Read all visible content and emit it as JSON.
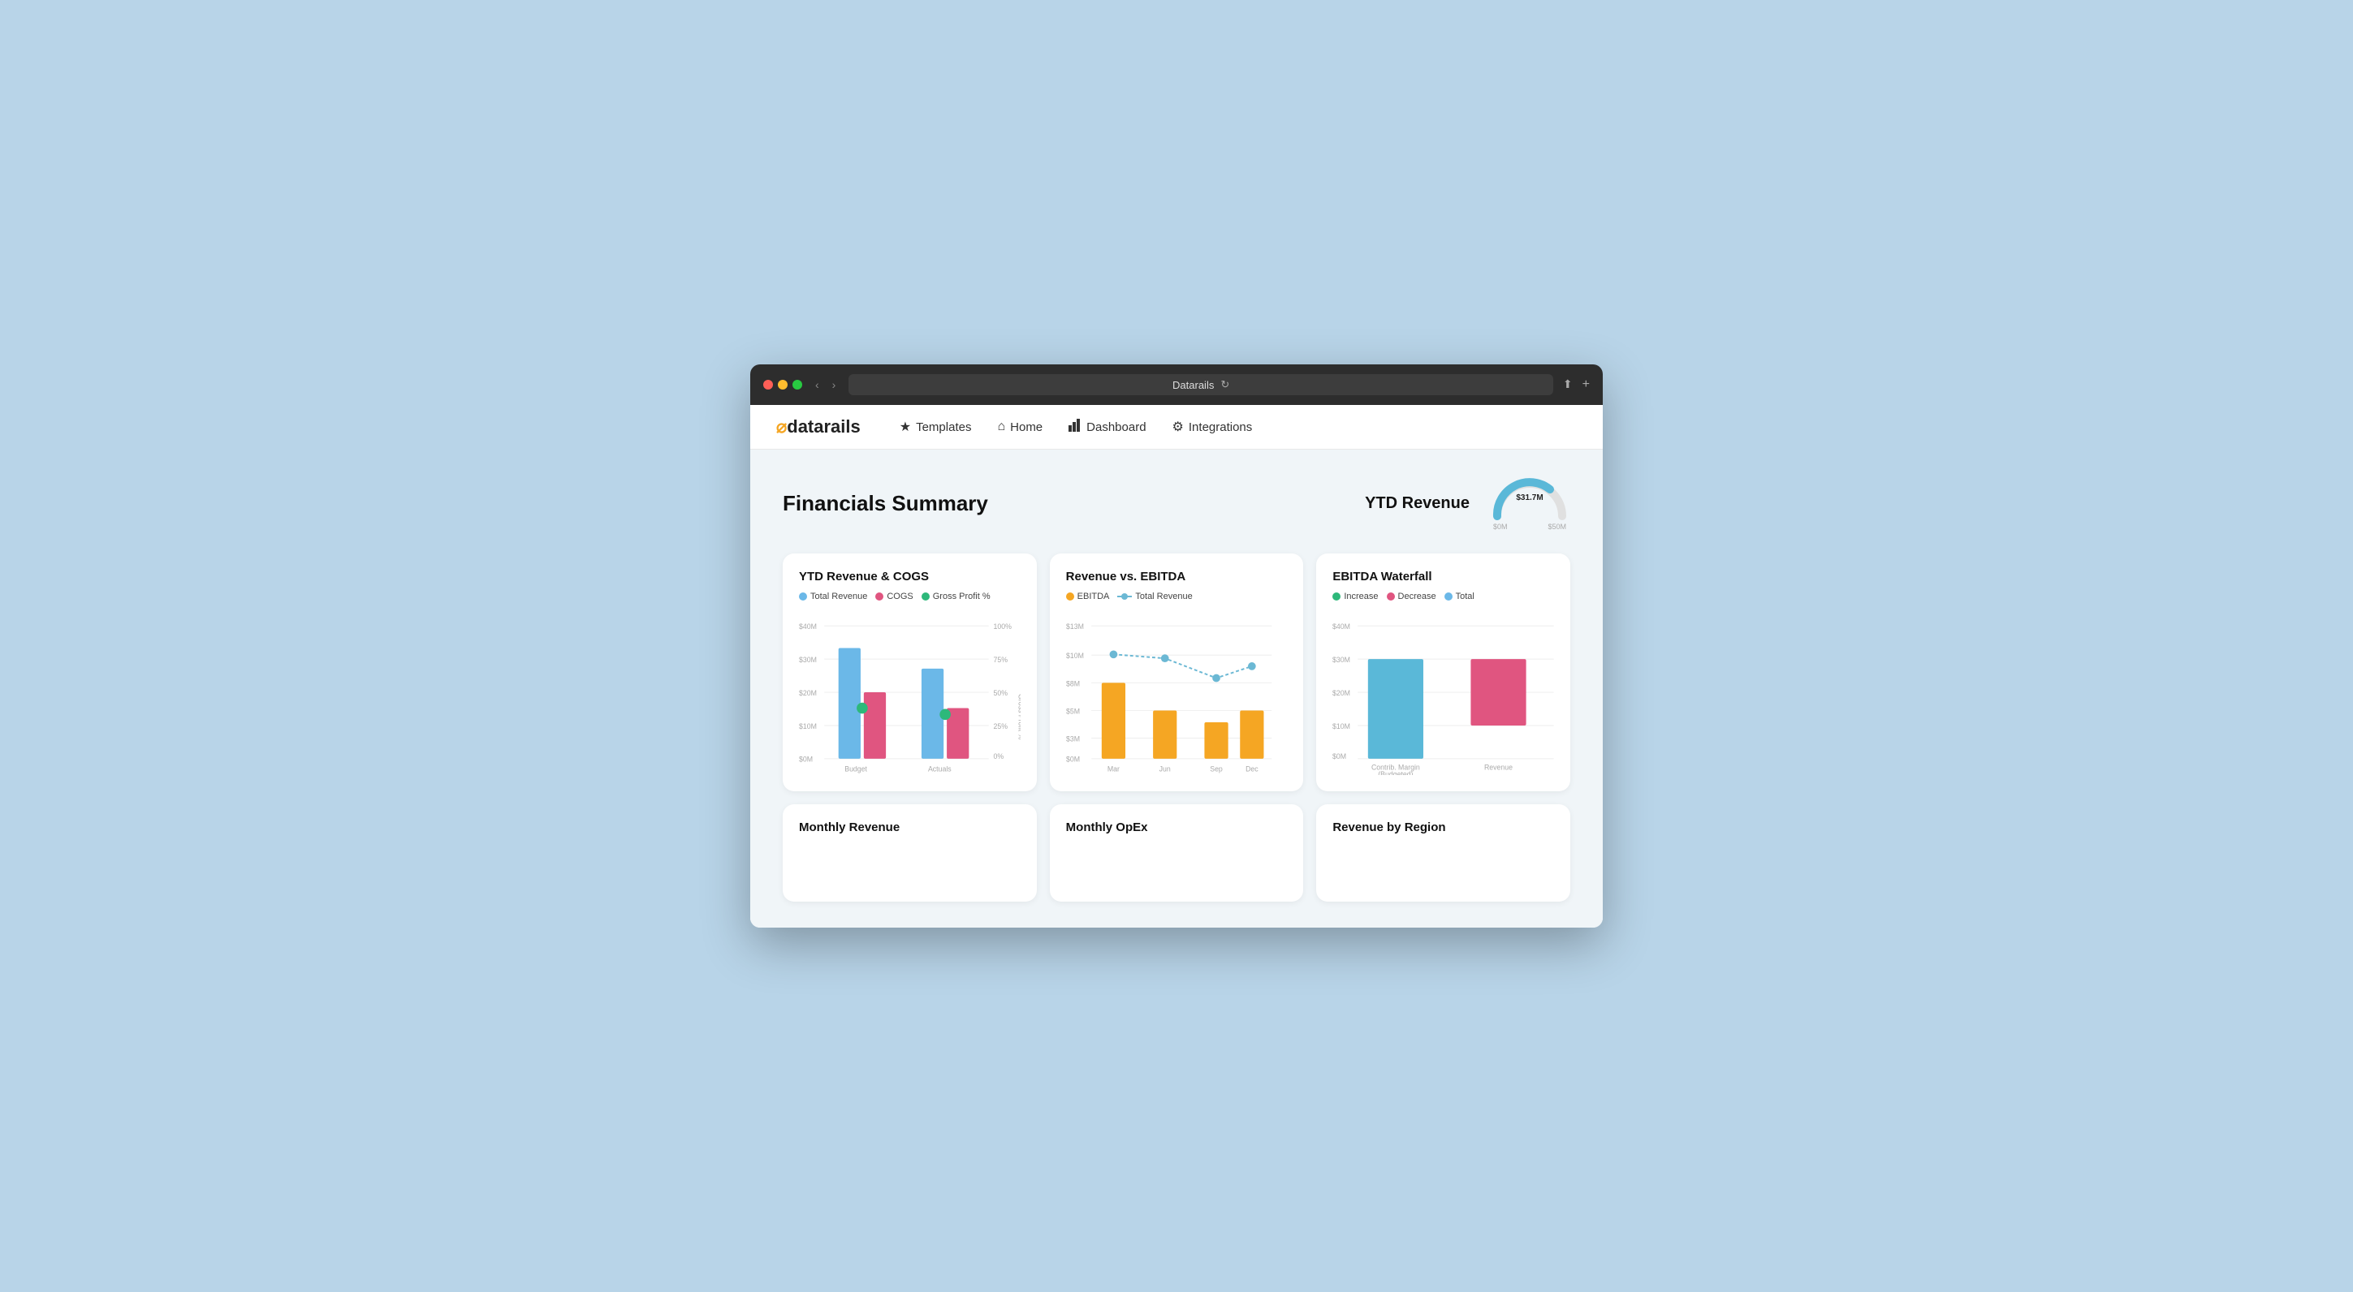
{
  "browser": {
    "title": "Datarails",
    "reload_icon": "↻"
  },
  "nav": {
    "logo": "datarails",
    "items": [
      {
        "id": "templates",
        "icon": "★",
        "label": "Templates"
      },
      {
        "id": "home",
        "icon": "⌂",
        "label": "Home"
      },
      {
        "id": "dashboard",
        "icon": "📊",
        "label": "Dashboard"
      },
      {
        "id": "integrations",
        "icon": "⚙",
        "label": "Integrations"
      }
    ]
  },
  "page": {
    "title": "Financials Summary",
    "ytd_label": "YTD Revenue",
    "ytd_value": "$31.7M",
    "ytd_min": "$0M",
    "ytd_max": "$50M"
  },
  "charts": [
    {
      "id": "ytd-revenue-cogs",
      "title": "YTD Revenue & COGS",
      "legend": [
        {
          "color": "#6bb8e8",
          "label": "Total Revenue",
          "type": "dot"
        },
        {
          "color": "#e05580",
          "label": "COGS",
          "type": "dot"
        },
        {
          "color": "#2db87a",
          "label": "Gross Profit %",
          "type": "dot"
        }
      ],
      "x_labels": [
        "Budget",
        "Actuals"
      ],
      "y_labels": [
        "$40M",
        "$30M",
        "$20M",
        "$10M",
        "$0M"
      ],
      "y_right_labels": [
        "100%",
        "75%",
        "50%",
        "25%",
        "0%"
      ]
    },
    {
      "id": "revenue-vs-ebitda",
      "title": "Revenue vs. EBITDA",
      "legend": [
        {
          "color": "#f5a623",
          "label": "EBITDA",
          "type": "dot"
        },
        {
          "color": "#6bb8d4",
          "label": "Total Revenue",
          "type": "line"
        }
      ],
      "x_labels": [
        "Mar",
        "Jun",
        "Sep",
        "Dec"
      ],
      "y_labels": [
        "$13M",
        "$10M",
        "$8M",
        "$5M",
        "$3M",
        "$0M"
      ]
    },
    {
      "id": "ebitda-waterfall",
      "title": "EBITDA Waterfall",
      "legend": [
        {
          "color": "#2db87a",
          "label": "Increase",
          "type": "dot"
        },
        {
          "color": "#e05580",
          "label": "Decrease",
          "type": "dot"
        },
        {
          "color": "#6bb8e8",
          "label": "Total",
          "type": "dot"
        }
      ],
      "x_labels": [
        "Contrib. Margin (Budgeted)",
        "Revenue"
      ],
      "y_labels": [
        "$40M",
        "$30M",
        "$20M",
        "$10M",
        "$0M"
      ]
    }
  ],
  "bottom_cards": [
    {
      "id": "monthly-revenue",
      "title": "Monthly Revenue"
    },
    {
      "id": "monthly-opex",
      "title": "Monthly OpEx"
    },
    {
      "id": "revenue-by-region",
      "title": "Revenue by Region"
    }
  ],
  "waterfall_detail": {
    "gross_profit": "Gross Profit",
    "increase": "Increase",
    "decrease": "Decrease"
  }
}
